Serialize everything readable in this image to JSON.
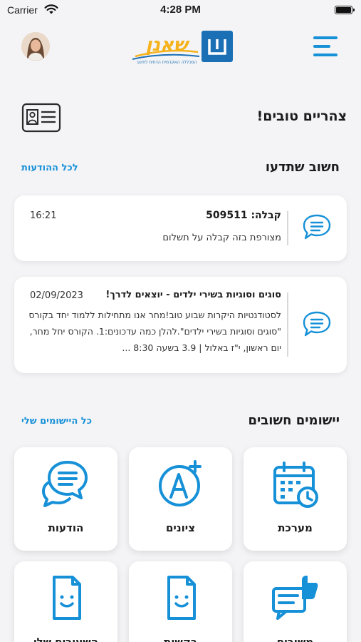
{
  "status_bar": {
    "carrier": "Carrier",
    "time": "4:28 PM"
  },
  "header": {
    "logo_text": "שאנן",
    "logo_subtitle": "המכללה האקדמית הדתית לחינוך"
  },
  "greeting": {
    "text": "צהריים טובים!"
  },
  "announcements": {
    "title": "חשוב שתדעו",
    "link_label": "לכל ההודעות",
    "items": [
      {
        "title": "קבלה: 509511",
        "meta": "16:21",
        "body": "מצורפת בזה קבלה על תשלום"
      },
      {
        "title": "סוגים וסוגיות בשירי ילדים - יוצאים לדרך!",
        "meta": "02/09/2023",
        "body": "לסטודנטיות היקרות שבוע טוב!מחר אנו מתחילות ללמוד יחד בקורס \"סוגים וסוגיות בשירי ילדים\".להלן כמה עדכונים:1. הקורס יחל מחר, יום ראשון, י\"ז באלול | 3.9 בשעה 8:30 ..."
      }
    ]
  },
  "apps": {
    "title": "יישומים חשובים",
    "link_label": "כל היישומים שלי",
    "tiles": [
      {
        "label": "מערכת",
        "icon": "calendar-icon"
      },
      {
        "label": "ציונים",
        "icon": "grade-icon"
      },
      {
        "label": "הודעות",
        "icon": "messages-icon"
      },
      {
        "label": "משובים",
        "icon": "feedback-icon"
      },
      {
        "label": "בקשות",
        "icon": "requests-icon"
      },
      {
        "label": "השעורים שלי",
        "icon": "lessons-icon"
      }
    ]
  },
  "colors": {
    "accent": "#1690d7",
    "background": "#f4f4f6",
    "card": "#ffffff"
  }
}
